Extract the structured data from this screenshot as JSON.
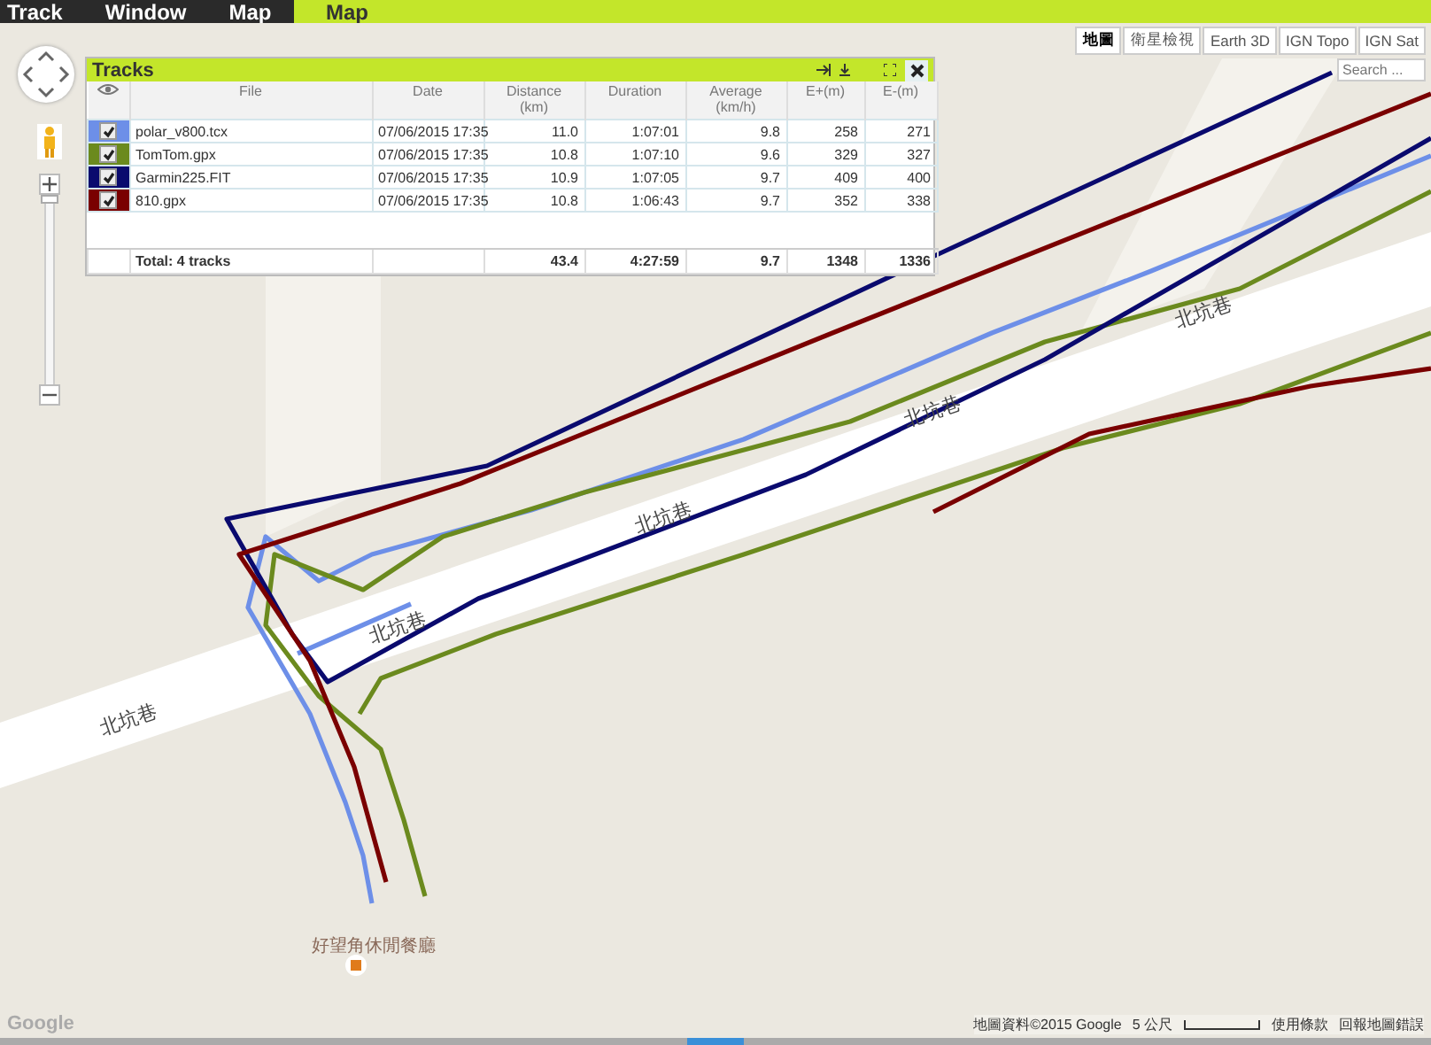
{
  "menu": [
    {
      "label": "Track"
    },
    {
      "label": "Window"
    },
    {
      "label": "Map"
    }
  ],
  "section_title": "Map",
  "map_types": [
    {
      "label": "地圖",
      "selected": true
    },
    {
      "label": "衛星檢視",
      "selected": false
    },
    {
      "label": "Earth 3D",
      "selected": false
    },
    {
      "label": "IGN Topo",
      "selected": false
    },
    {
      "label": "IGN Sat",
      "selected": false
    }
  ],
  "search": {
    "placeholder": "Search ..."
  },
  "tracks_panel": {
    "title": "Tracks",
    "columns": [
      {
        "label": "File"
      },
      {
        "label": "Date"
      },
      {
        "label": "Distance",
        "unit": "(km)"
      },
      {
        "label": "Duration"
      },
      {
        "label": "Average",
        "unit": "(km/h)"
      },
      {
        "label": "E+(m)"
      },
      {
        "label": "E-(m)"
      }
    ],
    "rows": [
      {
        "file": "polar_v800.tcx",
        "date": "07/06/2015 17:35",
        "distance": "11.0",
        "duration": "1:07:01",
        "average": "9.8",
        "e_plus": "258",
        "e_minus": "271",
        "color": "#6d8fe8",
        "checked": true
      },
      {
        "file": "TomTom.gpx",
        "date": "07/06/2015 17:35",
        "distance": "10.8",
        "duration": "1:07:10",
        "average": "9.6",
        "e_plus": "329",
        "e_minus": "327",
        "color": "#6b8a1e",
        "checked": true
      },
      {
        "file": "Garmin225.FIT",
        "date": "07/06/2015 17:35",
        "distance": "10.9",
        "duration": "1:07:05",
        "average": "9.7",
        "e_plus": "409",
        "e_minus": "400",
        "color": "#0a0a6e",
        "checked": true
      },
      {
        "file": "810.gpx",
        "date": "07/06/2015 17:35",
        "distance": "10.8",
        "duration": "1:06:43",
        "average": "9.7",
        "e_plus": "352",
        "e_minus": "338",
        "color": "#7a0000",
        "checked": true
      }
    ],
    "total": {
      "label": "Total: 4 tracks",
      "distance": "43.4",
      "duration": "4:27:59",
      "average": "9.7",
      "e_plus": "1348",
      "e_minus": "1336"
    }
  },
  "map": {
    "zoom": {
      "level": 1
    },
    "street_labels": [
      "北坑巷",
      "北坑巷",
      "北坑巷",
      "北坑巷",
      "北坑巷"
    ],
    "place": "好望角休閒餐廳",
    "logo": "Google",
    "attribution": "地圖資料©2015 Google",
    "scale": "5 公尺",
    "terms": "使用條款",
    "report": "回報地圖錯誤"
  }
}
